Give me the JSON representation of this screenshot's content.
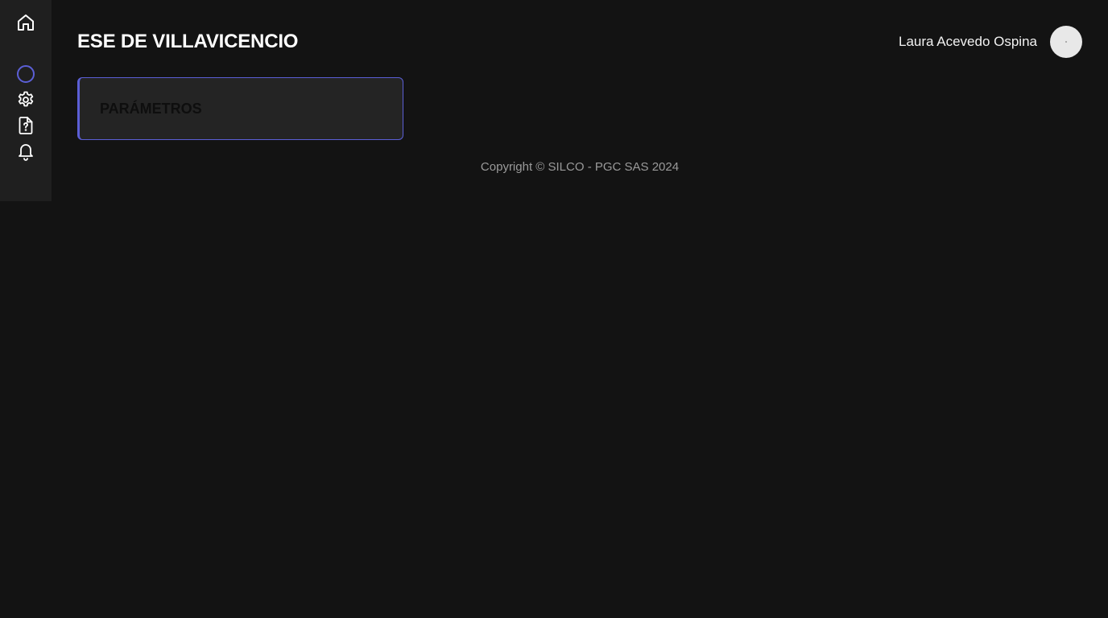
{
  "app": {
    "title": "ESE DE VILLAVICENCIO",
    "accent_color": "#5b5fd6"
  },
  "sidebar": {
    "items": [
      {
        "name": "home",
        "icon": "home-icon"
      },
      {
        "name": "status",
        "icon": "circle-icon"
      },
      {
        "name": "settings",
        "icon": "gear-icon"
      },
      {
        "name": "help",
        "icon": "file-question-icon"
      },
      {
        "name": "notifications",
        "icon": "bell-icon"
      }
    ]
  },
  "header": {
    "user_name": "Laura Acevedo Ospina",
    "avatar_icon": "user-avatar"
  },
  "main": {
    "cards": [
      {
        "label": "PARÁMETROS"
      }
    ]
  },
  "footer": {
    "copyright": "Copyright © SILCO - PGC SAS 2024"
  }
}
